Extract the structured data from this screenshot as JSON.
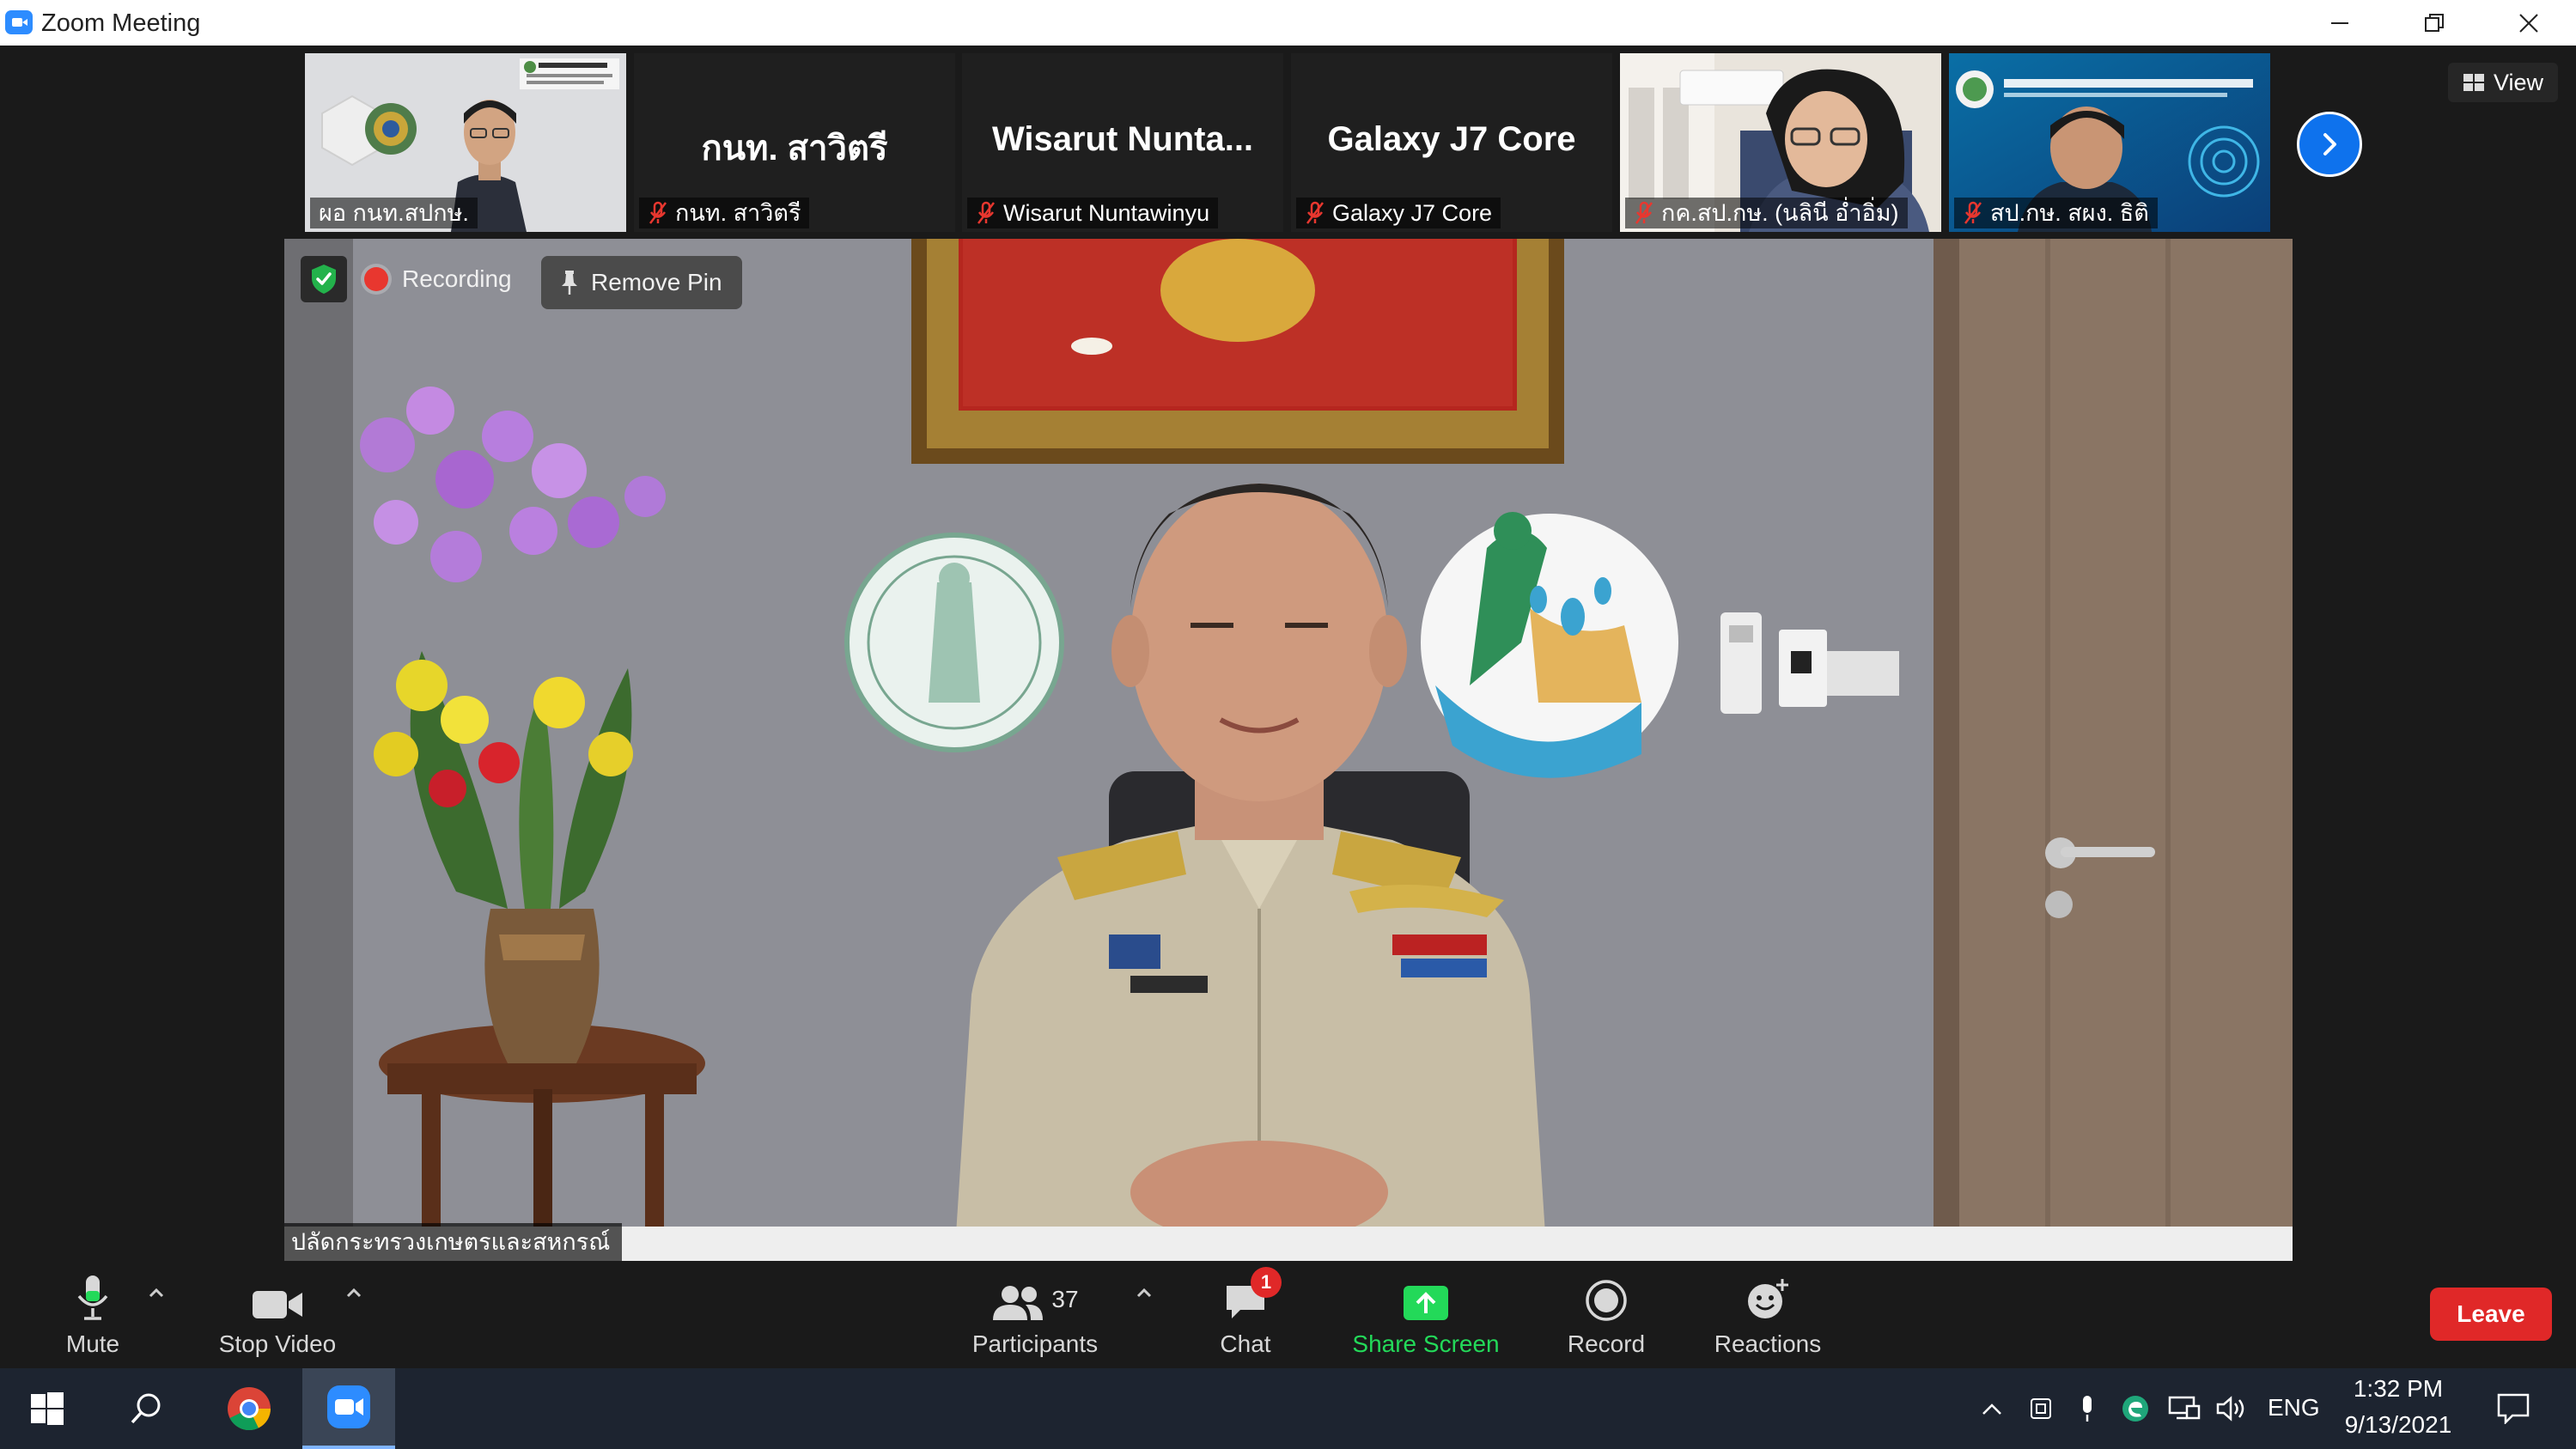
{
  "window": {
    "title": "Zoom Meeting"
  },
  "thumbnails": [
    {
      "label": "ผอ กนท.สปกษ.",
      "muted": false,
      "video": true
    },
    {
      "big_name": "กนท. สาวิตรี",
      "label": "กนท. สาวิตรี",
      "muted": true,
      "video": false
    },
    {
      "big_name": "Wisarut  Nunta...",
      "label": "Wisarut Nuntawinyu",
      "muted": true,
      "video": false
    },
    {
      "big_name": "Galaxy J7 Core",
      "label": "Galaxy J7 Core",
      "muted": true,
      "video": false
    },
    {
      "label": "กค.สป.กษ. (นลินี อ่ำอิ่ม)",
      "muted": true,
      "video": true
    },
    {
      "label": "สป.กษ. สผง. ธิติ",
      "muted": true,
      "video": true
    }
  ],
  "view_button": {
    "label": "View"
  },
  "main_video": {
    "recording_label": "Recording",
    "remove_pin_label": "Remove Pin",
    "speaker_name": "ปลัดกระทรวงเกษตรและสหกรณ์"
  },
  "toolbar": {
    "mute_label": "Mute",
    "stop_video_label": "Stop Video",
    "participants_label": "Participants",
    "participants_count": "37",
    "chat_label": "Chat",
    "chat_badge": "1",
    "share_screen_label": "Share Screen",
    "record_label": "Record",
    "reactions_label": "Reactions",
    "leave_label": "Leave"
  },
  "taskbar": {
    "language": "ENG",
    "time": "1:32 PM",
    "date": "9/13/2021"
  },
  "colors": {
    "zoom_blue": "#2d8cff",
    "leave_red": "#e02828",
    "share_green": "#23d959",
    "muted_red": "#e8372f"
  }
}
